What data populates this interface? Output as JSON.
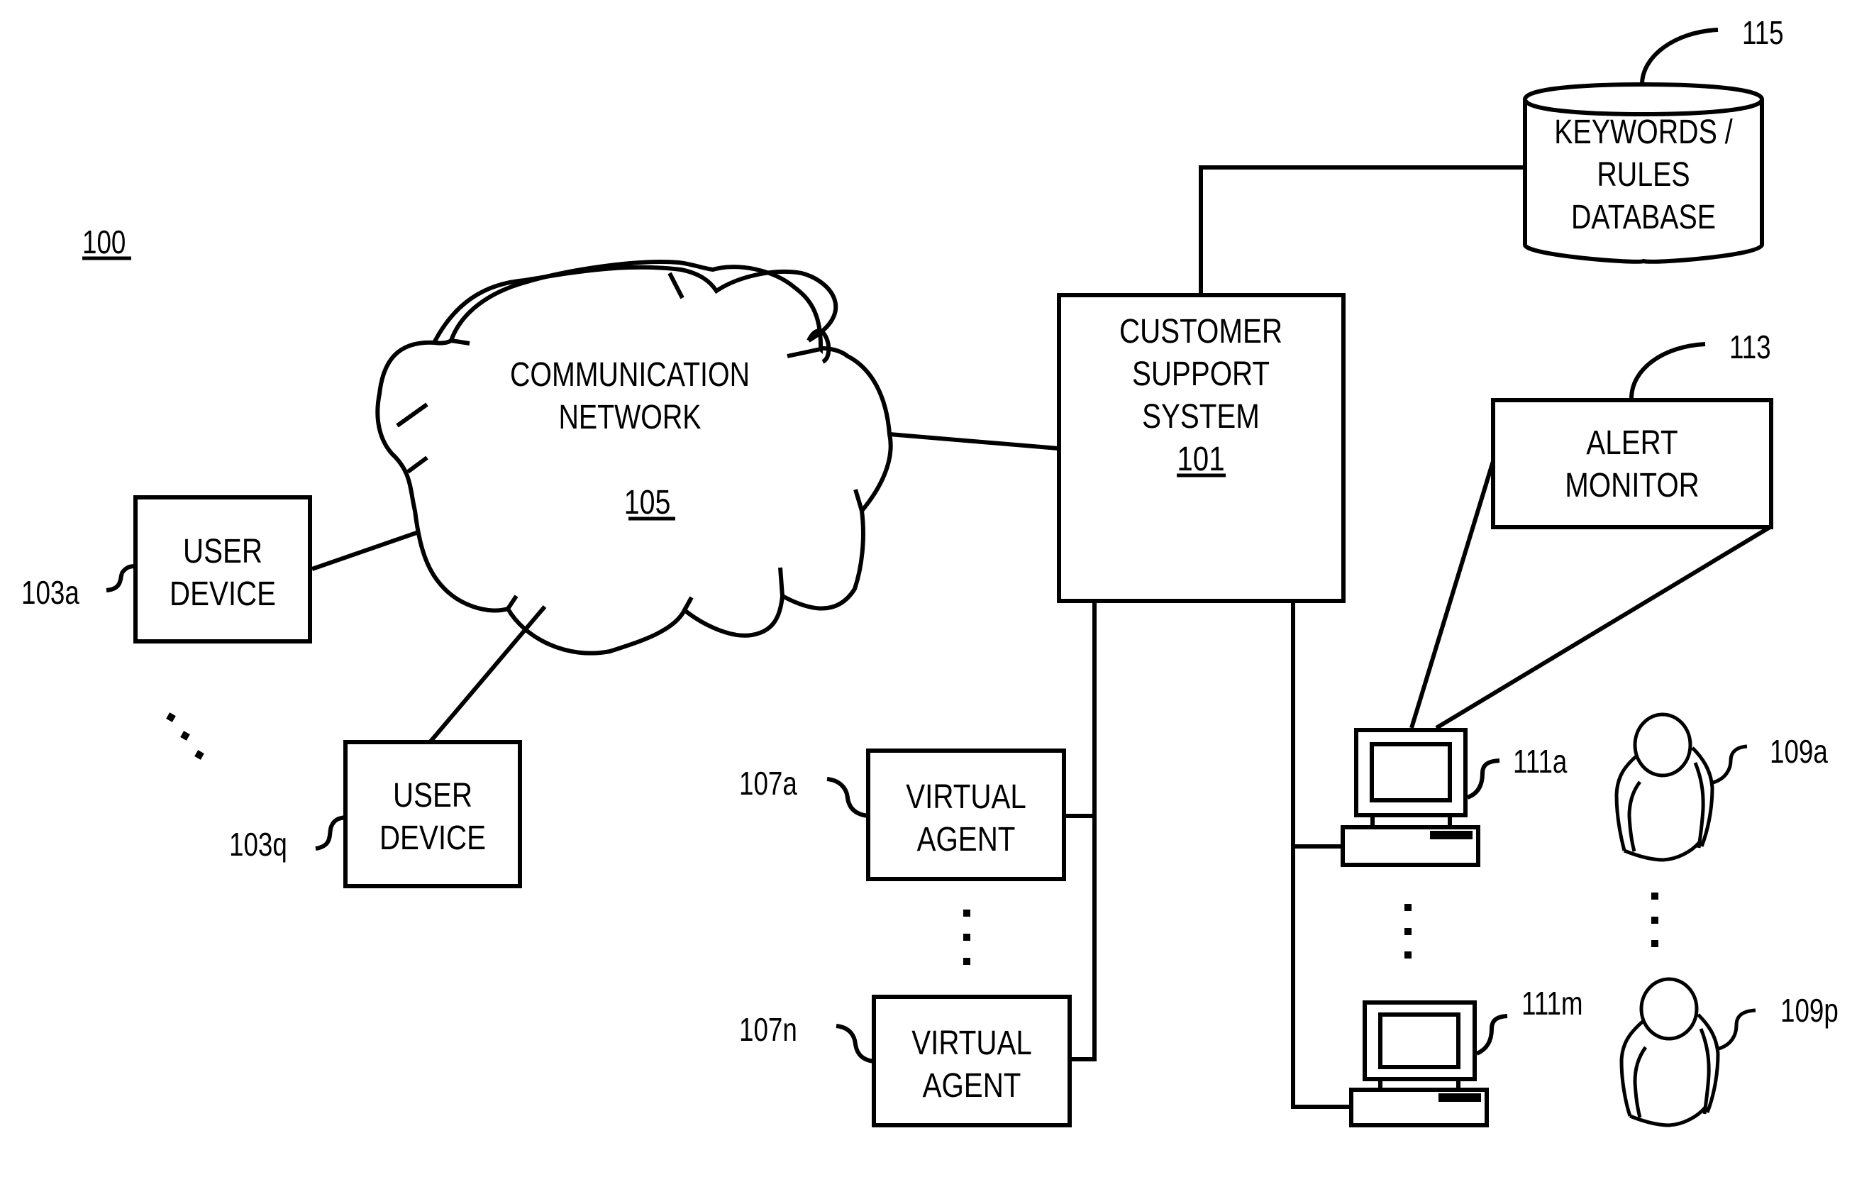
{
  "figure": {
    "number": "100",
    "colors": {
      "line": "#000000",
      "background": "#ffffff"
    }
  },
  "nodes": {
    "communication_network": {
      "lines": [
        "COMMUNICATION",
        "NETWORK"
      ],
      "ref": "105"
    },
    "customer_support_system": {
      "lines": [
        "CUSTOMER",
        "SUPPORT",
        "SYSTEM"
      ],
      "ref": "101"
    },
    "keywords_rules_database": {
      "lines": [
        "KEYWORDS /",
        "RULES",
        "DATABASE"
      ],
      "ref": "115"
    },
    "alert_monitor": {
      "lines": [
        "ALERT",
        "MONITOR"
      ],
      "ref": "113"
    },
    "user_device_a": {
      "lines": [
        "USER",
        "DEVICE"
      ],
      "ref": "103a"
    },
    "user_device_q": {
      "lines": [
        "USER",
        "DEVICE"
      ],
      "ref": "103q"
    },
    "virtual_agent_a": {
      "lines": [
        "VIRTUAL",
        "AGENT"
      ],
      "ref": "107a"
    },
    "virtual_agent_n": {
      "lines": [
        "VIRTUAL",
        "AGENT"
      ],
      "ref": "107n"
    },
    "agent_station_a": {
      "icon": "computer-icon",
      "ref": "111a"
    },
    "agent_station_m": {
      "icon": "computer-icon",
      "ref": "111m"
    },
    "human_agent_a": {
      "icon": "person-icon",
      "ref": "109a"
    },
    "human_agent_p": {
      "icon": "person-icon",
      "ref": "109p"
    }
  },
  "edges": [
    [
      "user_device_a",
      "communication_network"
    ],
    [
      "user_device_q",
      "communication_network"
    ],
    [
      "communication_network",
      "customer_support_system"
    ],
    [
      "customer_support_system",
      "keywords_rules_database"
    ],
    [
      "customer_support_system",
      "virtual_agent_a"
    ],
    [
      "customer_support_system",
      "virtual_agent_n"
    ],
    [
      "customer_support_system",
      "agent_station_a"
    ],
    [
      "customer_support_system",
      "agent_station_m"
    ],
    [
      "alert_monitor",
      "agent_station_a"
    ]
  ]
}
